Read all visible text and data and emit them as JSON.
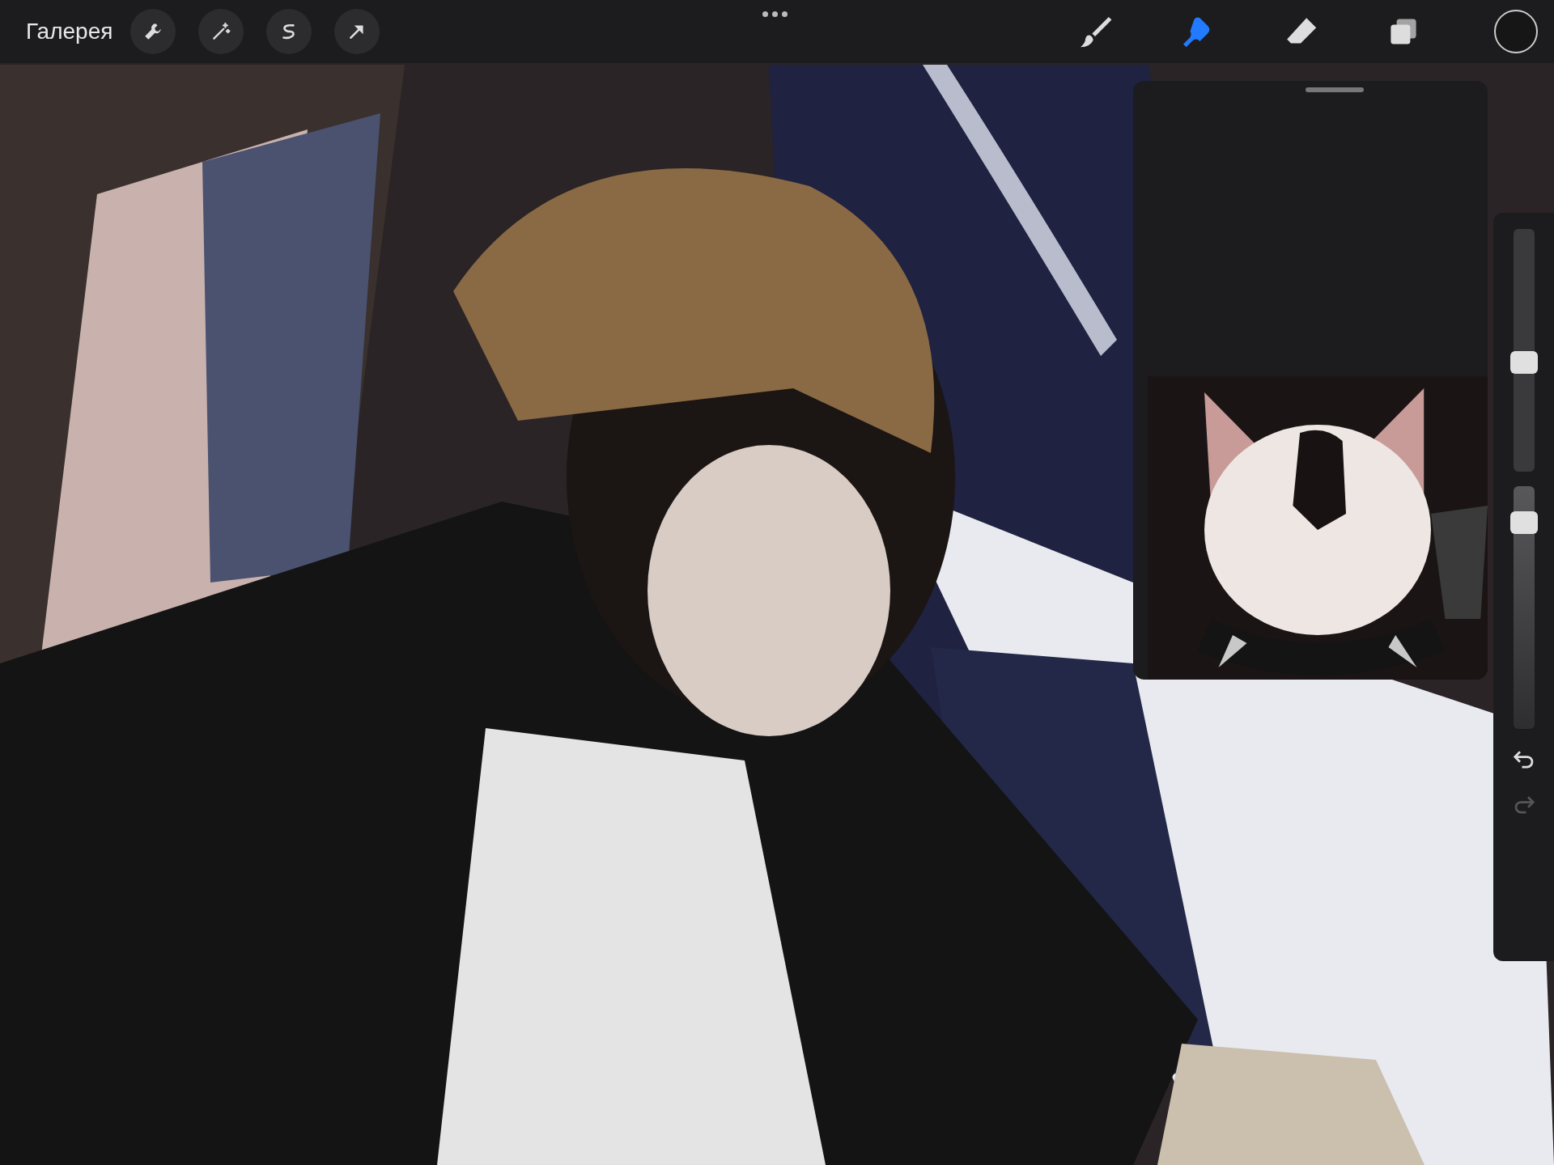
{
  "toolbar": {
    "gallery_label": "Галерея",
    "left_tools": [
      {
        "kind": "wrench",
        "selected": false
      },
      {
        "kind": "wand",
        "selected": false
      },
      {
        "kind": "selection",
        "selected": false
      },
      {
        "kind": "transform",
        "selected": false
      }
    ],
    "right_tools": [
      {
        "kind": "brush",
        "selected": false
      },
      {
        "kind": "smudge",
        "selected": true
      },
      {
        "kind": "eraser",
        "selected": false
      },
      {
        "kind": "layers",
        "selected": false
      }
    ]
  },
  "sidebar": {
    "sliders": [
      {
        "kind": "size",
        "level": 0.45
      },
      {
        "kind": "opacity",
        "level": 0.85
      }
    ],
    "buttons": [
      {
        "kind": "undo",
        "disabled": false
      },
      {
        "kind": "redo",
        "disabled": true
      }
    ]
  }
}
